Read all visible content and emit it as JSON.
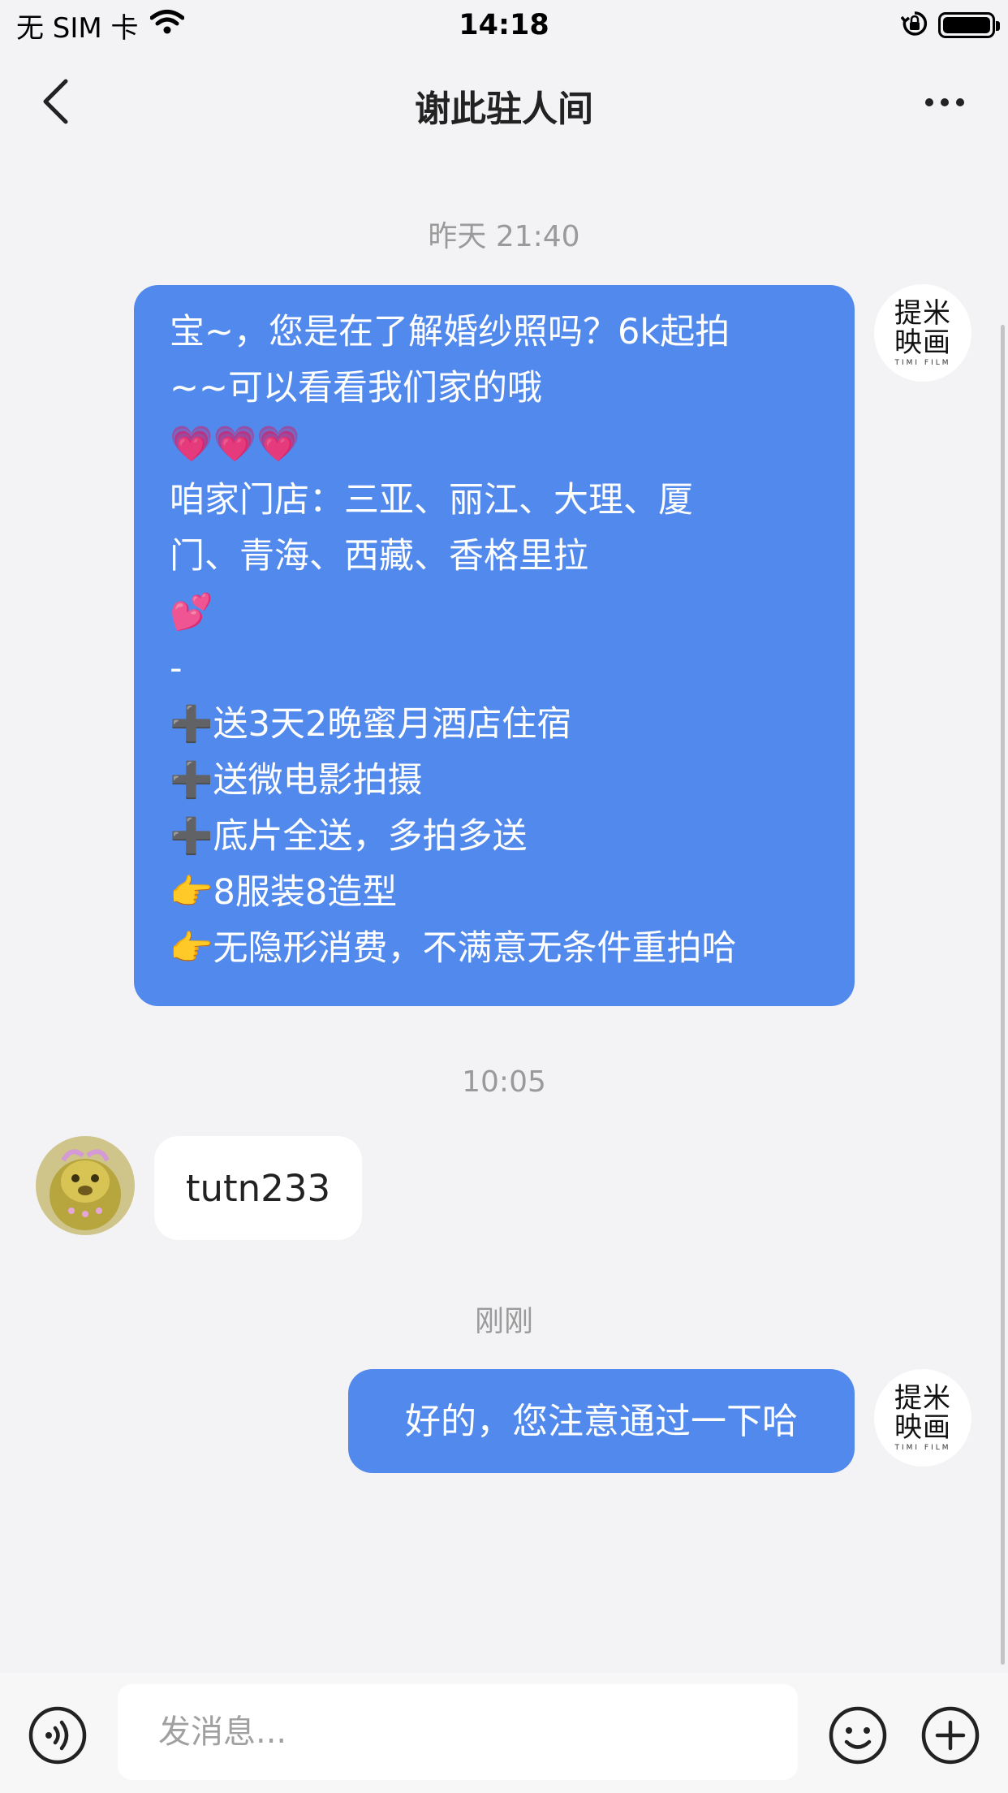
{
  "status_bar": {
    "carrier": "无 SIM 卡",
    "time": "14:18"
  },
  "nav": {
    "title": "谢此驻人间"
  },
  "messages": {
    "ts1": "昨天 21:40",
    "msg1_lines": [
      "宝~，您是在了解婚纱照吗？6k起拍",
      "~~可以看看我们家的哦",
      "💗💗💗",
      "咱家门店：三亚、丽江、大理、厦",
      "门、青海、西藏、香格里拉",
      "💕",
      "-",
      "➕送3天2晚蜜月酒店住宿",
      "➕送微电影拍摄",
      "➕底片全送，多拍多送",
      "👉8服装8造型",
      "👉无隐形消费，不满意无条件重拍哈"
    ],
    "ts2": "10:05",
    "msg2": "tutn233",
    "ts3": "刚刚",
    "msg3": "好的，您注意通过一下哈"
  },
  "brand_avatar": {
    "line1": "提米",
    "line2": "映画",
    "sub": "TIMI FILM"
  },
  "input": {
    "placeholder": "发消息..."
  },
  "colors": {
    "bubble_blue": "#5289ec",
    "background": "#f3f3f5"
  }
}
